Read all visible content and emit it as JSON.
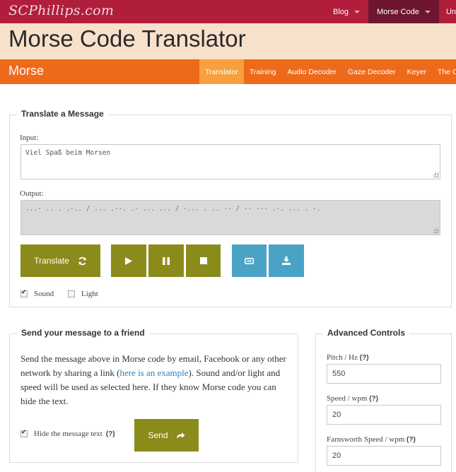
{
  "site": {
    "logo": "SCPhillips.com"
  },
  "topnav": [
    {
      "label": "Blog",
      "active": false,
      "caret": true
    },
    {
      "label": "Morse Code",
      "active": true,
      "caret": true
    },
    {
      "label": "Un",
      "active": false,
      "caret": false
    }
  ],
  "page": {
    "title": "Morse Code Translator"
  },
  "section": {
    "title": "Morse"
  },
  "subnav": [
    {
      "label": "Translator",
      "active": true
    },
    {
      "label": "Training",
      "active": false
    },
    {
      "label": "Audio Decoder",
      "active": false
    },
    {
      "label": "Gaze Decoder",
      "active": false
    },
    {
      "label": "Keyer",
      "active": false
    },
    {
      "label": "The Code",
      "active": false
    }
  ],
  "translate": {
    "legend": "Translate a Message",
    "input_label": "Input:",
    "input_value": "Viel Spaß beim Morsen",
    "output_label": "Output:",
    "output_value": "...- .. . .-.. / ... .--. .- ... ... / -... . .. -- / -- --- .-. ... . -.",
    "translate_label": "Translate",
    "sound_label": "Sound",
    "sound_checked": true,
    "light_label": "Light",
    "light_checked": false
  },
  "send": {
    "legend": "Send your message to a friend",
    "text_before": "Send the message above in Morse code by email, Facebook or any other network by sharing a link (",
    "link_text": "here is an example",
    "text_after": "). Sound and/or light and speed will be used as selected here. If they know Morse code you can hide the text.",
    "hide_label": "Hide the message text",
    "hide_help": "(?)",
    "hide_checked": true,
    "send_label": "Send"
  },
  "advanced": {
    "legend": "Advanced Controls",
    "pitch_label": "Pitch / Hz",
    "pitch_value": "550",
    "speed_label": "Speed / wpm",
    "speed_value": "20",
    "farnsworth_label": "Farnsworth Speed / wpm",
    "farnsworth_value": "20",
    "help": "(?)"
  },
  "colors": {
    "topbar": "#b01e3c",
    "topnav_active": "#6e1530",
    "title_band": "#f7e1ca",
    "orange_bar": "#ee6a1b",
    "subnav_active": "#f7a03d",
    "olive_button": "#8b8b1c",
    "blue_button": "#4aa3c4",
    "link": "#2f80b8"
  },
  "icons": {
    "translate": "refresh-icon",
    "play": "play-icon",
    "pause": "pause-icon",
    "stop": "stop-icon",
    "link": "link-icon",
    "download": "download-icon",
    "send": "share-arrow-icon"
  }
}
